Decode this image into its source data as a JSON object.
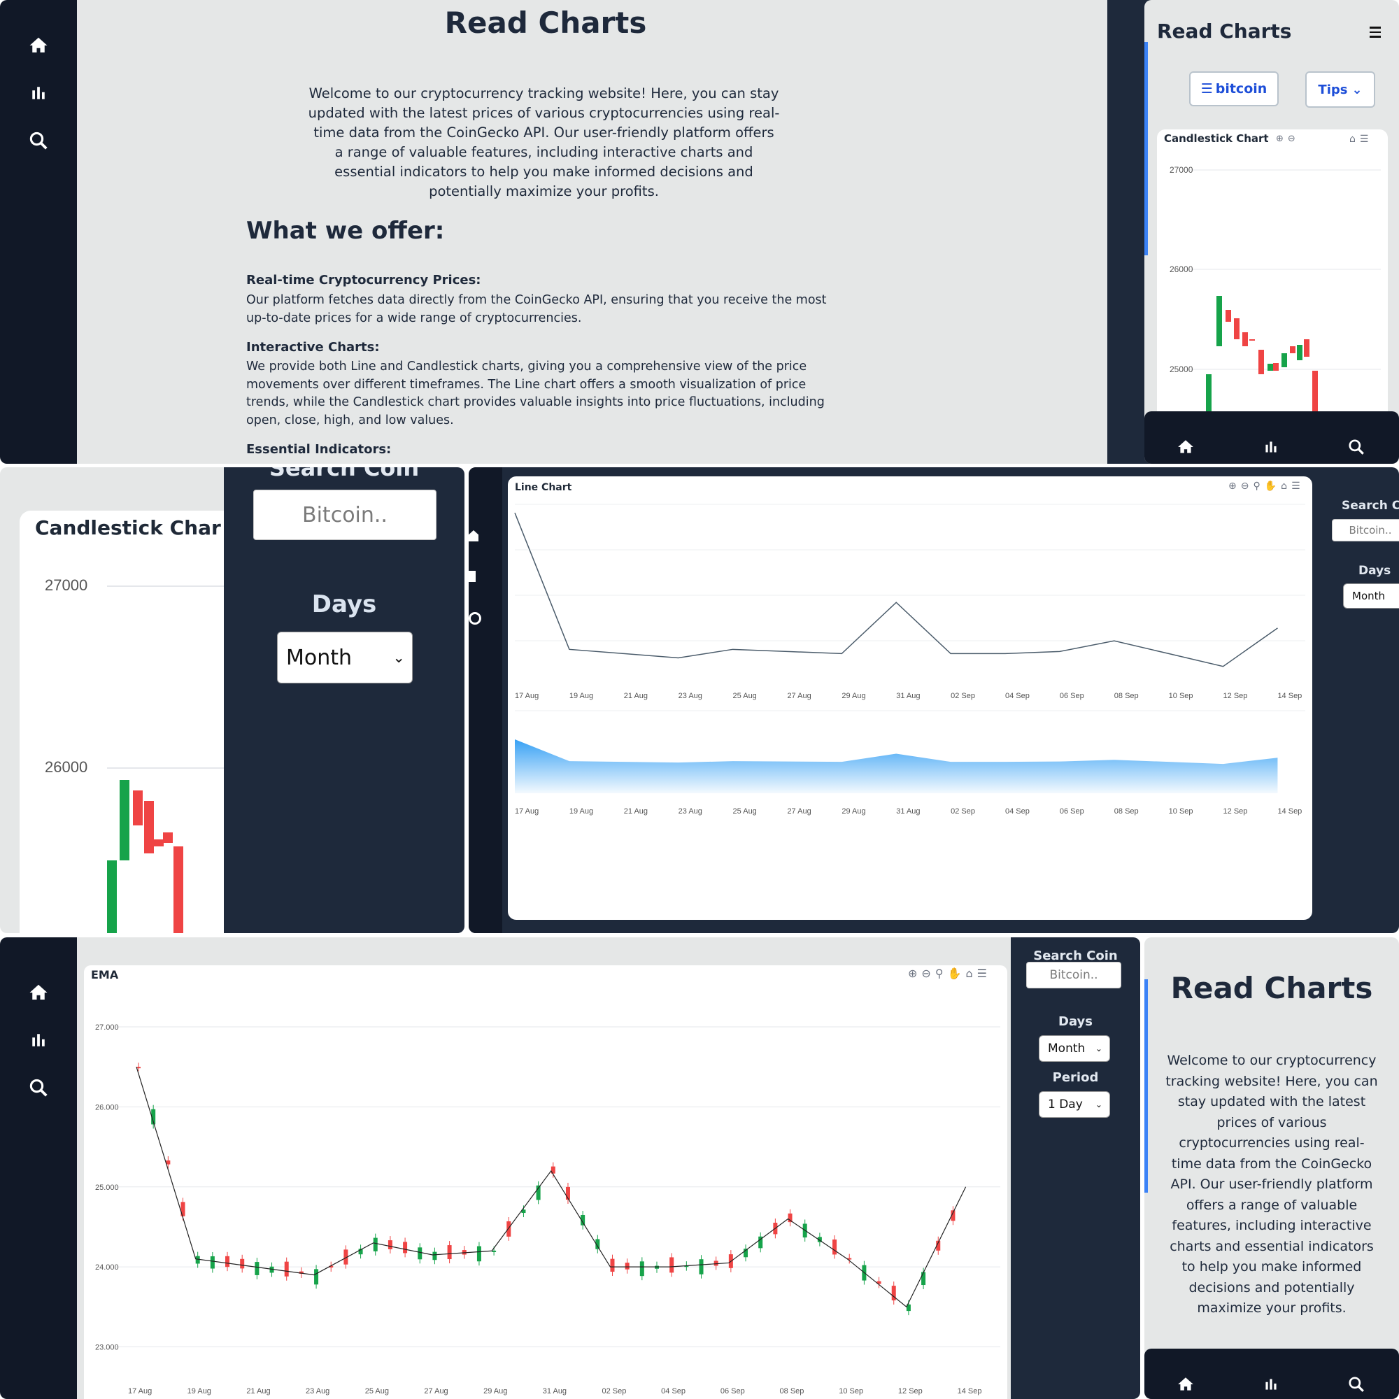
{
  "app": {
    "title": "Read Charts"
  },
  "intro": "Welcome to our cryptocurrency tracking website! Here, you can stay updated with the latest prices of various cryptocurrencies using real-time data from the CoinGecko API. Our user-friendly platform offers a range of valuable features, including interactive charts and essential indicators to help you make informed decisions and potentially maximize your profits.",
  "offer": {
    "heading": "What we offer:",
    "items": [
      {
        "title": "Real-time Cryptocurrency Prices:",
        "body": "Our platform fetches data directly from the CoinGecko API, ensuring that you receive the most up-to-date prices for a wide range of cryptocurrencies."
      },
      {
        "title": "Interactive Charts:",
        "body": "We provide both Line and Candlestick charts, giving you a comprehensive view of the price movements over different timeframes. The Line chart offers a smooth visualization of price trends, while the Candlestick chart provides valuable insights into price fluctuations, including open, close, high, and low values."
      },
      {
        "title": "Essential Indicators:",
        "body": ""
      }
    ]
  },
  "mobile": {
    "menu_icon": "hamburger-icon",
    "coin_button": "bitcoin",
    "tips_button": "Tips",
    "candle_title": "Candlestick Chart",
    "y_ticks": [
      "27000",
      "26000",
      "25000"
    ]
  },
  "zoom_panel": {
    "candle_title": "Candlestick Char",
    "y_ticks": [
      "27000",
      "26000"
    ],
    "search_heading": "Search Coin",
    "search_placeholder": "Bitcoin..",
    "days_label": "Days",
    "days_value": "Month"
  },
  "line_panel": {
    "title": "Line Chart",
    "search_label": "Search Coi",
    "search_placeholder": "Bitcoin..",
    "days_label": "Days",
    "days_value": "Month"
  },
  "ema_panel": {
    "title": "EMA",
    "search_label": "Search Coin",
    "search_placeholder": "Bitcoin..",
    "days_label": "Days",
    "days_value": "Month",
    "period_label": "Period",
    "period_value": "1 Day"
  },
  "colors": {
    "up": "#16a34a",
    "down": "#ef4444",
    "line": "#4b5c6b",
    "area": "#2196f3",
    "accent": "#1d4ed8"
  },
  "chart_data": [
    {
      "type": "line",
      "title": "Line Chart",
      "x": [
        "17 Aug",
        "19 Aug",
        "21 Aug",
        "23 Aug",
        "25 Aug",
        "27 Aug",
        "29 Aug",
        "31 Aug",
        "02 Sep",
        "04 Sep",
        "06 Sep",
        "08 Sep",
        "10 Sep",
        "12 Sep",
        "14 Sep"
      ],
      "series": [
        {
          "values": [
            29400,
            26200,
            26100,
            26000,
            26200,
            26150,
            26100,
            27300,
            26100,
            26100,
            26150,
            26400,
            26100,
            25800,
            26700
          ]
        }
      ]
    },
    {
      "type": "line",
      "title": "EMA",
      "x": [
        "17 Aug",
        "19 Aug",
        "21 Aug",
        "23 Aug",
        "25 Aug",
        "27 Aug",
        "29 Aug",
        "31 Aug",
        "02 Sep",
        "04 Sep",
        "06 Sep",
        "08 Sep",
        "10 Sep",
        "12 Sep",
        "14 Sep"
      ],
      "series": [
        {
          "values": [
            26500,
            24100,
            24000,
            23900,
            24300,
            24150,
            24200,
            25200,
            24000,
            24000,
            24050,
            24600,
            24100,
            23500,
            25000
          ]
        }
      ],
      "yticks": [
        "27.000",
        "26.000",
        "25.000",
        "24.000",
        "23.000"
      ],
      "ylim": [
        23000,
        27000
      ]
    }
  ]
}
